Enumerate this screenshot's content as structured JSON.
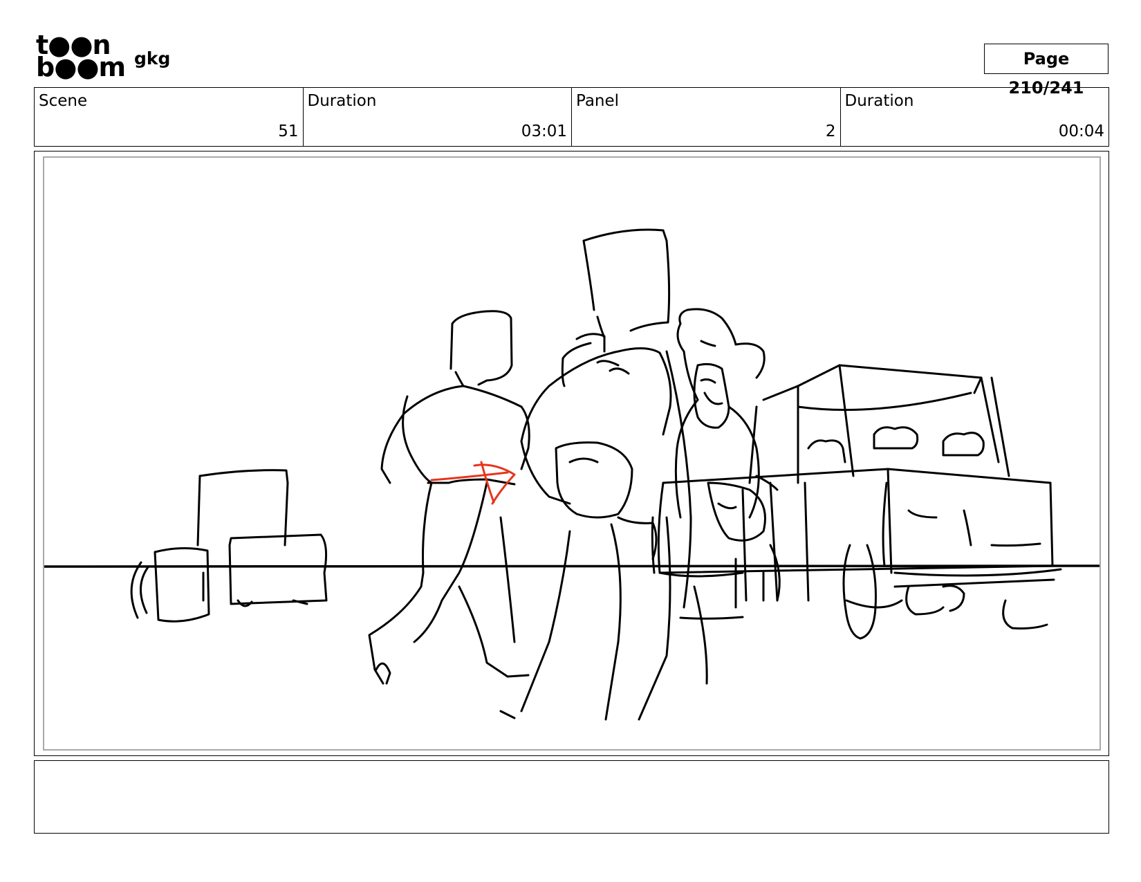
{
  "header": {
    "logo_line1": "t●●n",
    "logo_line2": "b●●m",
    "project_title": "gkg",
    "page_label": "Page 210/241"
  },
  "info": {
    "scene_label": "Scene",
    "scene_value": "51",
    "scene_duration_label": "Duration",
    "scene_duration_value": "03:01",
    "panel_label": "Panel",
    "panel_value": "2",
    "panel_duration_label": "Duration",
    "panel_duration_value": "00:04"
  },
  "notes": {
    "text": ""
  },
  "colors": {
    "sketch_line": "#000000",
    "annotation": "#e8341c",
    "inner_frame": "#a8a8a8"
  }
}
